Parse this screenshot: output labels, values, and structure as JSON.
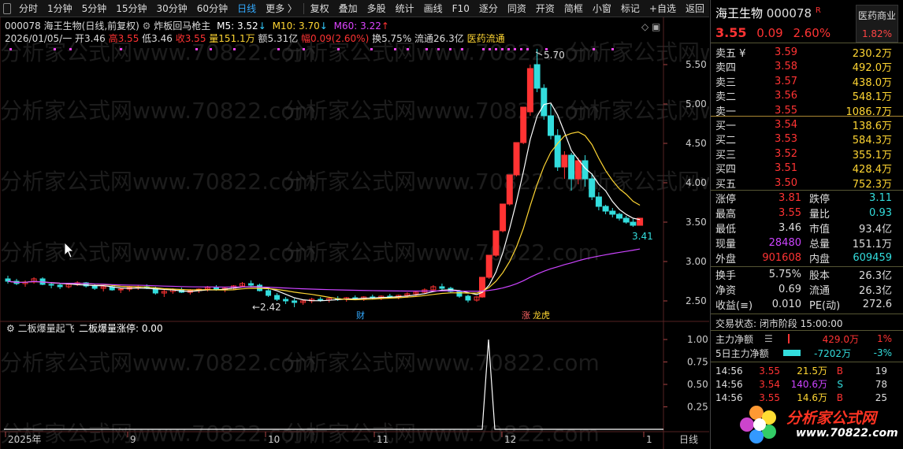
{
  "toolbar": {
    "items": [
      "分时",
      "1分钟",
      "5分钟",
      "15分钟",
      "30分钟",
      "60分钟",
      "日线",
      "更多 〉",
      "复权",
      "叠加",
      "多股",
      "统计",
      "画线",
      "F10",
      "逐分",
      "同资",
      "开资",
      "简框",
      "小窗",
      "标记",
      "+自选",
      "返回"
    ],
    "active": "日线"
  },
  "header": {
    "code": "000078",
    "name": "海王生物",
    "period": "(日线,前复权)",
    "indicator_name": "炸板回马枪主",
    "ma5_label": "M5: 3.52",
    "ma10_label": "M10: 3.70",
    "ma60_label": "M60: 3.22",
    "arrow_down": "↓",
    "arrow_up": "↑",
    "date_line": "2026/01/05/一",
    "open": "开3.46",
    "high": "高3.55",
    "low": "低3.46",
    "close": "收3.55",
    "volume": "量151.1万",
    "amount": "额5.31亿",
    "change": "幅0.09(2.60%)",
    "turnover": "换5.75%",
    "float": "流通26.3亿",
    "sector": "医药流通"
  },
  "sub_indicator": {
    "name": "二板爆量起飞",
    "value_label": "二板爆量涨停: 0.00"
  },
  "annotations": {
    "max_label": "5.70",
    "min_label": "2.42",
    "last_label": "3.41",
    "tag_cai": "财",
    "tag_zhang": "涨",
    "tag_longhu": "龙虎"
  },
  "watermark": "分析家公式网www.70822.com",
  "chart_data": {
    "type": "candlestick",
    "y_ticks": [
      "5.50",
      "5.00",
      "4.50",
      "4.00",
      "3.50",
      "3.00",
      "2.50"
    ],
    "y_range": [
      2.42,
      5.7
    ],
    "sub_y_ticks": [
      "1.00",
      "0.75",
      "0.50",
      "0.25"
    ],
    "x_ticks": [
      "2025年",
      "9",
      "10",
      "11",
      "12",
      "1"
    ],
    "period_label": "日线",
    "candles": [
      [
        2.78,
        2.82,
        2.72,
        2.75
      ],
      [
        2.75,
        2.78,
        2.7,
        2.72
      ],
      [
        2.72,
        2.76,
        2.68,
        2.74
      ],
      [
        2.74,
        2.8,
        2.72,
        2.78
      ],
      [
        2.78,
        2.8,
        2.7,
        2.71
      ],
      [
        2.71,
        2.74,
        2.66,
        2.7
      ],
      [
        2.7,
        2.73,
        2.65,
        2.68
      ],
      [
        2.68,
        2.72,
        2.66,
        2.71
      ],
      [
        2.71,
        2.75,
        2.69,
        2.73
      ],
      [
        2.73,
        2.74,
        2.67,
        2.69
      ],
      [
        2.69,
        2.72,
        2.64,
        2.66
      ],
      [
        2.66,
        2.7,
        2.62,
        2.68
      ],
      [
        2.68,
        2.71,
        2.63,
        2.64
      ],
      [
        2.64,
        2.67,
        2.6,
        2.65
      ],
      [
        2.65,
        2.69,
        2.62,
        2.67
      ],
      [
        2.67,
        2.7,
        2.64,
        2.68
      ],
      [
        2.68,
        2.71,
        2.65,
        2.66
      ],
      [
        2.66,
        2.68,
        2.58,
        2.6
      ],
      [
        2.6,
        2.64,
        2.55,
        2.62
      ],
      [
        2.62,
        2.66,
        2.59,
        2.64
      ],
      [
        2.64,
        2.67,
        2.6,
        2.61
      ],
      [
        2.61,
        2.65,
        2.58,
        2.63
      ],
      [
        2.63,
        2.66,
        2.6,
        2.65
      ],
      [
        2.65,
        2.69,
        2.62,
        2.67
      ],
      [
        2.67,
        2.7,
        2.63,
        2.64
      ],
      [
        2.64,
        2.68,
        2.61,
        2.66
      ],
      [
        2.66,
        2.7,
        2.64,
        2.69
      ],
      [
        2.69,
        2.74,
        2.67,
        2.72
      ],
      [
        2.72,
        2.76,
        2.68,
        2.7
      ],
      [
        2.7,
        2.72,
        2.62,
        2.63
      ],
      [
        2.63,
        2.65,
        2.55,
        2.57
      ],
      [
        2.57,
        2.6,
        2.5,
        2.52
      ],
      [
        2.52,
        2.55,
        2.46,
        2.5
      ],
      [
        2.5,
        2.53,
        2.42,
        2.48
      ],
      [
        2.48,
        2.52,
        2.45,
        2.5
      ],
      [
        2.5,
        2.54,
        2.47,
        2.52
      ],
      [
        2.52,
        2.55,
        2.49,
        2.51
      ],
      [
        2.51,
        2.54,
        2.48,
        2.53
      ],
      [
        2.53,
        2.56,
        2.5,
        2.52
      ],
      [
        2.52,
        2.55,
        2.49,
        2.54
      ],
      [
        2.54,
        2.57,
        2.51,
        2.53
      ],
      [
        2.53,
        2.56,
        2.5,
        2.55
      ],
      [
        2.55,
        2.58,
        2.52,
        2.54
      ],
      [
        2.54,
        2.57,
        2.51,
        2.56
      ],
      [
        2.56,
        2.59,
        2.53,
        2.55
      ],
      [
        2.55,
        2.58,
        2.52,
        2.57
      ],
      [
        2.57,
        2.61,
        2.54,
        2.59
      ],
      [
        2.59,
        2.63,
        2.56,
        2.61
      ],
      [
        2.61,
        2.66,
        2.59,
        2.64
      ],
      [
        2.64,
        2.7,
        2.62,
        2.68
      ],
      [
        2.68,
        2.72,
        2.64,
        2.66
      ],
      [
        2.66,
        2.68,
        2.6,
        2.62
      ],
      [
        2.62,
        2.64,
        2.54,
        2.56
      ],
      [
        2.56,
        2.58,
        2.48,
        2.51
      ],
      [
        2.51,
        2.56,
        2.49,
        2.55
      ],
      [
        2.55,
        2.8,
        2.54,
        2.8
      ],
      [
        2.8,
        3.08,
        2.78,
        3.08
      ],
      [
        3.08,
        3.39,
        3.06,
        3.39
      ],
      [
        3.39,
        3.73,
        3.37,
        3.73
      ],
      [
        3.73,
        4.1,
        3.71,
        4.1
      ],
      [
        4.1,
        4.51,
        4.08,
        4.51
      ],
      [
        4.51,
        4.96,
        4.49,
        4.96
      ],
      [
        4.9,
        5.5,
        4.85,
        5.45
      ],
      [
        5.5,
        5.7,
        5.15,
        5.2
      ],
      [
        5.2,
        5.25,
        4.8,
        4.85
      ],
      [
        4.85,
        5.0,
        4.55,
        4.6
      ],
      [
        4.6,
        4.68,
        4.15,
        4.2
      ],
      [
        4.2,
        4.4,
        4.05,
        4.35
      ],
      [
        4.35,
        4.38,
        3.9,
        4.05
      ],
      [
        4.05,
        4.32,
        3.98,
        4.28
      ],
      [
        4.28,
        4.35,
        3.95,
        4.05
      ],
      [
        4.05,
        4.12,
        3.78,
        3.82
      ],
      [
        3.82,
        3.88,
        3.65,
        3.7
      ],
      [
        3.7,
        3.72,
        3.6,
        3.64
      ],
      [
        3.64,
        3.68,
        3.56,
        3.6
      ],
      [
        3.6,
        3.62,
        3.52,
        3.55
      ],
      [
        3.55,
        3.58,
        3.48,
        3.5
      ],
      [
        3.5,
        3.54,
        3.44,
        3.46
      ],
      [
        3.46,
        3.55,
        3.46,
        3.55
      ]
    ]
  },
  "right": {
    "name": "海王生物",
    "code": "000078",
    "r_mark": "R",
    "price": "3.55",
    "chg": "0.09",
    "pct": "2.60%",
    "industry": "医药商业",
    "industry_pct": "1.82%",
    "asks": [
      {
        "label": "卖五 ¥",
        "price": "3.59",
        "vol": "230.2万"
      },
      {
        "label": "卖四",
        "price": "3.58",
        "vol": "492.0万"
      },
      {
        "label": "卖三",
        "price": "3.57",
        "vol": "438.0万"
      },
      {
        "label": "卖二",
        "price": "3.56",
        "vol": "548.1万"
      },
      {
        "label": "卖一",
        "price": "3.55",
        "vol": "1086.7万"
      }
    ],
    "bids": [
      {
        "label": "买一",
        "price": "3.54",
        "vol": "138.6万"
      },
      {
        "label": "买二",
        "price": "3.53",
        "vol": "584.3万"
      },
      {
        "label": "买三",
        "price": "3.52",
        "vol": "355.1万"
      },
      {
        "label": "买四",
        "price": "3.51",
        "vol": "428.4万"
      },
      {
        "label": "买五",
        "price": "3.50",
        "vol": "752.3万"
      }
    ],
    "stats1": [
      {
        "k1": "涨停",
        "v1": "3.81",
        "k2": "跌停",
        "v2": "3.11"
      },
      {
        "k1": "最高",
        "v1": "3.55",
        "k2": "量比",
        "v2": "0.93"
      },
      {
        "k1": "最低",
        "v1": "3.46",
        "k2": "市值",
        "v2": "93.4亿"
      },
      {
        "k1": "现量",
        "v1": "28480",
        "k2": "总量",
        "v2": "151.1万"
      },
      {
        "k1": "外盘",
        "v1": "901608",
        "k2": "内盘",
        "v2": "609459"
      }
    ],
    "stats2": [
      {
        "k1": "换手",
        "v1": "5.75%",
        "k2": "股本",
        "v2": "26.3亿"
      },
      {
        "k1": "净资",
        "v1": "0.69",
        "k2": "流通",
        "v2": "26.3亿"
      },
      {
        "k1": "收益(≡)",
        "v1": "0.010",
        "k2": "PE(动)",
        "v2": "272.6"
      }
    ],
    "trade_status": "交易状态: 闭市阶段 15:00:00",
    "flow1": {
      "label": "主力净额",
      "value": "429.0万",
      "pct": "1%"
    },
    "flow2": {
      "label": "5日主力净额",
      "value": "-7202万",
      "pct": "-3%"
    },
    "ticks": [
      {
        "t": "14:56",
        "p": "3.55",
        "v": "21.5万",
        "d": "B",
        "n": "19"
      },
      {
        "t": "14:56",
        "p": "3.54",
        "v": "140.6万",
        "d": "S",
        "n": "78"
      },
      {
        "t": "14:56",
        "p": "3.55",
        "v": "14.6万",
        "d": "B",
        "n": "25"
      }
    ],
    "logo_text": "分析家公式网",
    "logo_url": "www.70822.com"
  }
}
